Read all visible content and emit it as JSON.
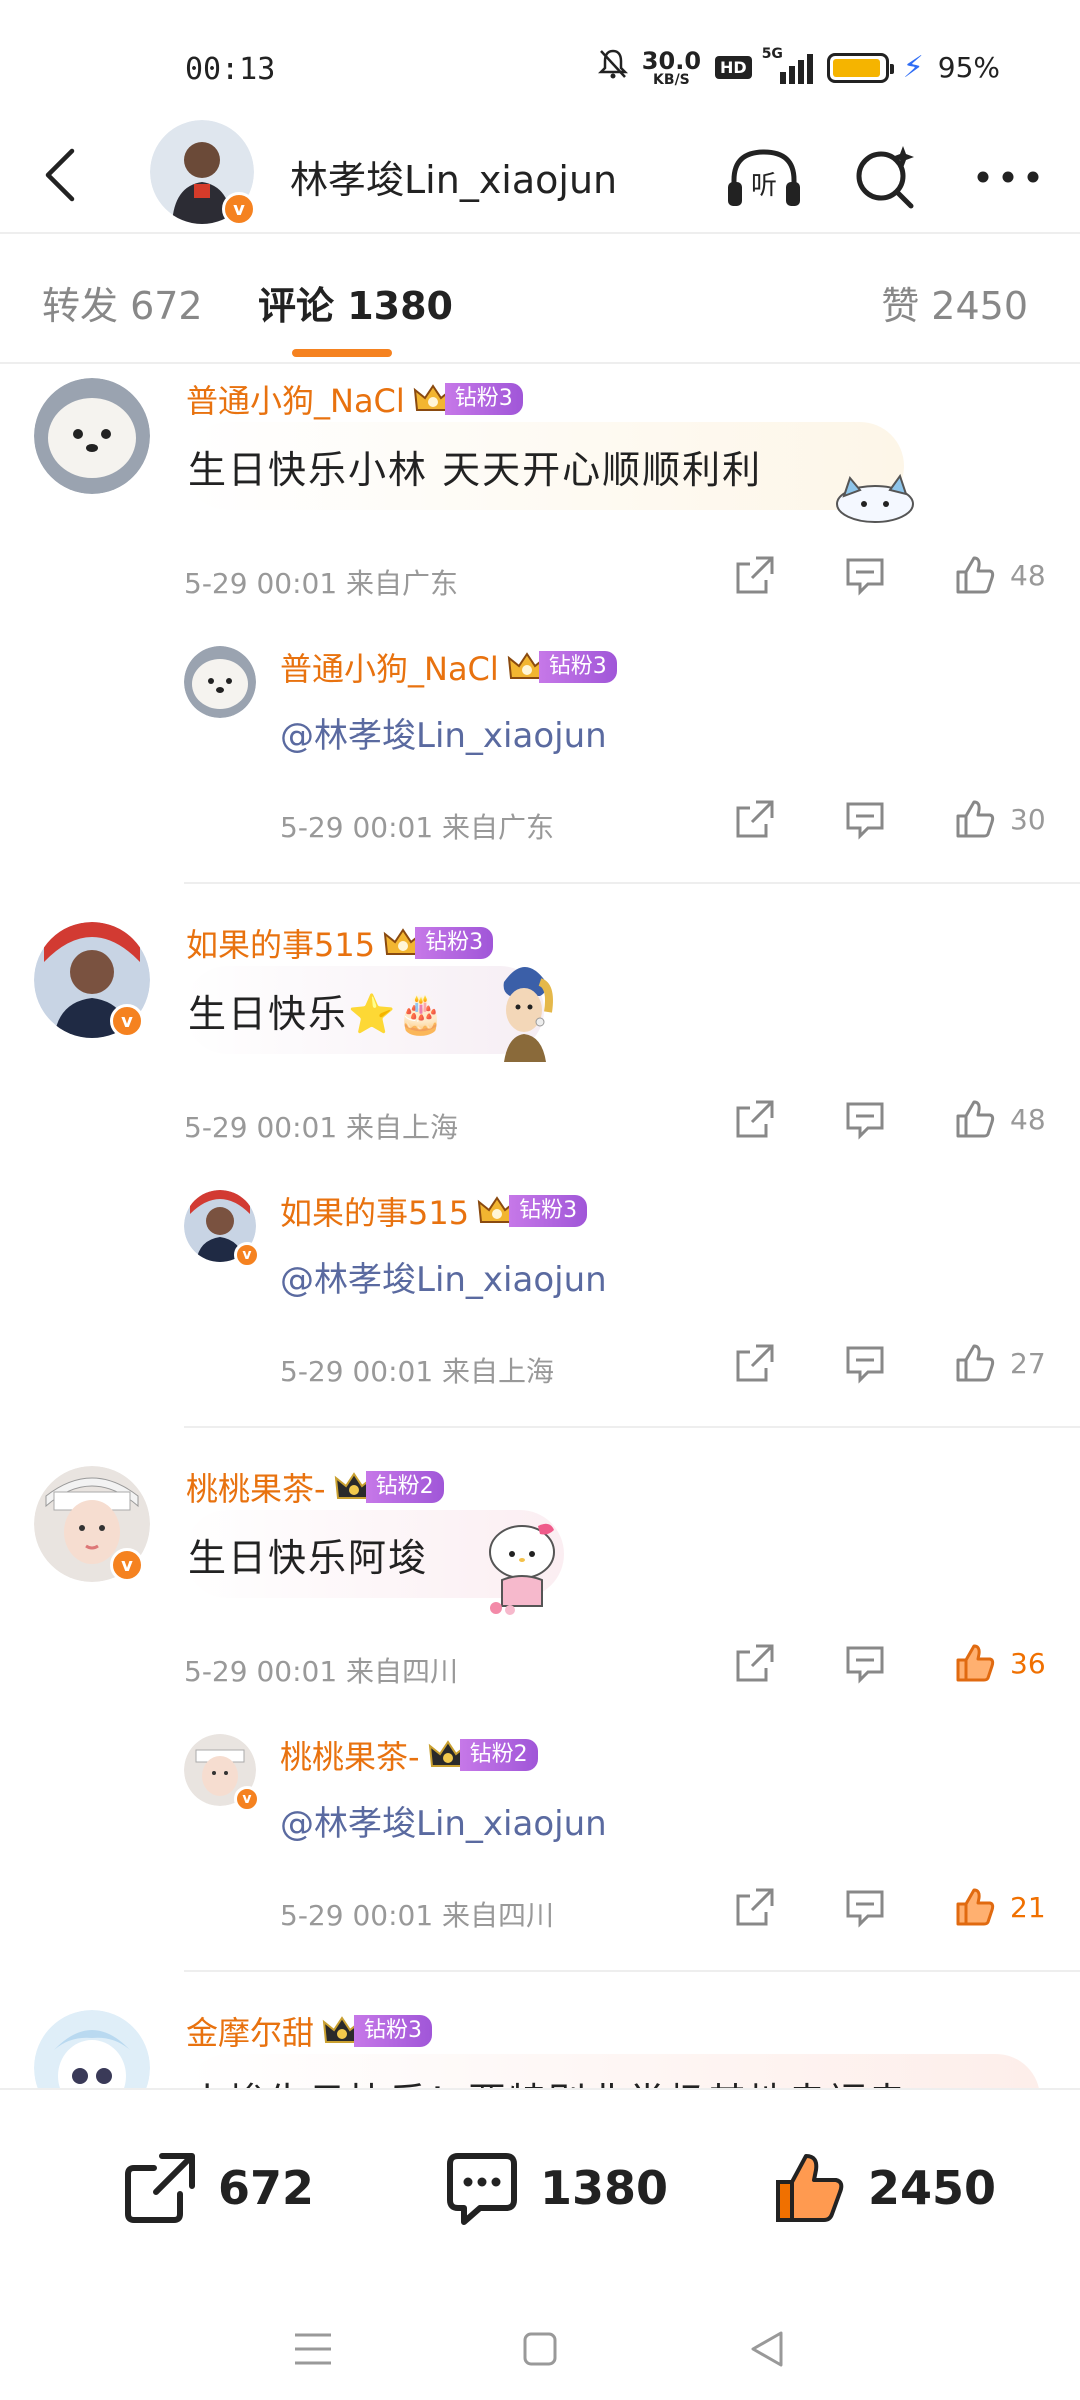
{
  "status_bar": {
    "time": "00:13",
    "net_speed_value": "30.0",
    "net_speed_unit": "KB/S",
    "hd": "HD",
    "network": "5G",
    "battery": "95%",
    "battery_level": 0.95
  },
  "header": {
    "name": "林孝埈Lin_xiaojun",
    "verified": "v"
  },
  "tabs": {
    "repost": "转发 672",
    "comment": "评论 1380",
    "like": "赞 2450"
  },
  "comments": [
    {
      "user": "普通小狗_NaCl",
      "fan_badge": "钻粉3",
      "text": "生日快乐小林 天天开心顺顺利利",
      "meta": "5-29 00:01  来自广东",
      "likes": "48",
      "liked": false,
      "reply": {
        "user": "普通小狗_NaCl",
        "fan_badge": "钻粉3",
        "text": "@林孝埈Lin_xiaojun",
        "meta": "5-29 00:01  来自广东",
        "likes": "30",
        "liked": false
      }
    },
    {
      "user": "如果的事515",
      "fan_badge": "钻粉3",
      "text": "生日快乐⭐🎂",
      "meta": "5-29 00:01  来自上海",
      "likes": "48",
      "liked": false,
      "reply": {
        "user": "如果的事515",
        "fan_badge": "钻粉3",
        "text": "@林孝埈Lin_xiaojun",
        "meta": "5-29 00:01  来自上海",
        "likes": "27",
        "liked": false
      }
    },
    {
      "user": "桃桃果茶-",
      "fan_badge": "钻粉2",
      "text": "生日快乐阿埈",
      "meta": "5-29 00:01  来自四川",
      "likes": "36",
      "liked": true,
      "reply": {
        "user": "桃桃果茶-",
        "fan_badge": "钻粉2",
        "text": "@林孝埈Lin_xiaojun",
        "meta": "5-29 00:01  来自四川",
        "likes": "21",
        "liked": true
      }
    },
    {
      "user": "金摩尔甜",
      "fan_badge": "钻粉3",
      "text": "小埈生日快乐！要特别非常极其地幸福幸"
    }
  ],
  "bottom_bar": {
    "repost_count": "672",
    "comment_count": "1380",
    "like_count": "2450"
  },
  "colors": {
    "accent": "#f58220",
    "username": "#e8720f",
    "mention": "#5a6aa0",
    "fan_badge": "#b066e0",
    "liked": "#f07000"
  },
  "icons": {
    "header": [
      "back-arrow-icon",
      "headphones-listen-icon",
      "search-sparkle-icon",
      "more-dots-icon"
    ],
    "row": [
      "share-icon",
      "reply-icon",
      "like-icon"
    ],
    "nav": [
      "menu-icon",
      "home-square-icon",
      "back-triangle-icon"
    ]
  }
}
